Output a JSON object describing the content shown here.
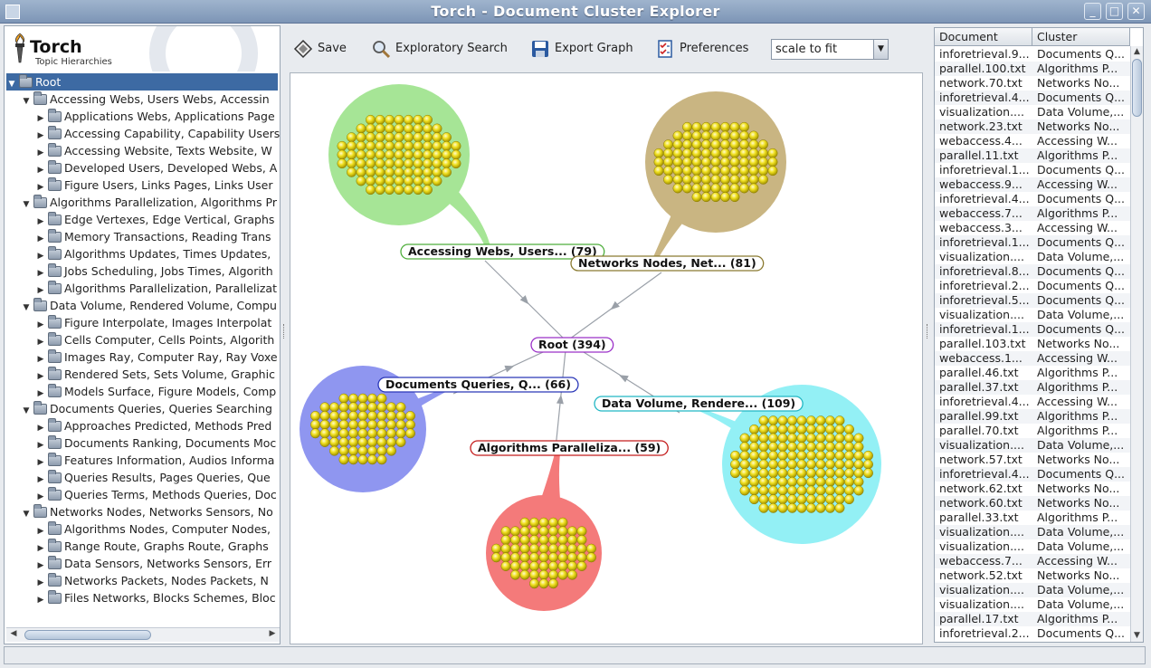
{
  "window": {
    "title": "Torch - Document Cluster Explorer",
    "minimize": "_",
    "maximize": "□",
    "close": "✕"
  },
  "logo": {
    "title": "Torch",
    "subtitle": "Topic Hierarchies"
  },
  "tree": {
    "root": "Root",
    "groups": [
      {
        "label": "Accessing Webs, Users Webs, Accessin",
        "children": [
          "Applications Webs, Applications Page",
          "Accessing Capability, Capability Users",
          "Accessing Website, Texts Website, W",
          "Developed Users, Developed Webs, A",
          "Figure Users, Links Pages, Links User"
        ]
      },
      {
        "label": "Algorithms Parallelization, Algorithms Pr",
        "children": [
          "Edge Vertexes, Edge Vertical, Graphs",
          "Memory Transactions, Reading Trans",
          "Algorithms Updates, Times Updates,",
          "Jobs Scheduling, Jobs Times, Algorith",
          "Algorithms Parallelization, Parallelizat"
        ]
      },
      {
        "label": "Data Volume, Rendered Volume, Compu",
        "children": [
          "Figure Interpolate, Images Interpolat",
          "Cells Computer, Cells Points, Algorith",
          "Images Ray, Computer Ray, Ray Voxe",
          "Rendered Sets, Sets Volume, Graphic",
          "Models Surface, Figure Models, Comp"
        ]
      },
      {
        "label": "Documents Queries, Queries Searching",
        "children": [
          "Approaches Predicted, Methods Pred",
          "Documents Ranking, Documents Moc",
          "Features Information, Audios Informa",
          "Queries Results, Pages Queries, Que",
          "Queries Terms, Methods Queries, Doc"
        ]
      },
      {
        "label": "Networks Nodes, Networks Sensors, No",
        "children": [
          "Algorithms Nodes, Computer Nodes,",
          "Range Route, Graphs Route, Graphs",
          "Data Sensors, Networks Sensors, Err",
          "Networks Packets, Nodes Packets, N",
          "Files Networks, Blocks Schemes, Bloc"
        ]
      }
    ]
  },
  "toolbar": {
    "save": "Save",
    "search": "Exploratory Search",
    "export": "Export Graph",
    "preferences": "Preferences",
    "scale": "scale to fit"
  },
  "graph": {
    "root_label": "Root (394)",
    "clusters": [
      {
        "label": "Accessing Webs, Users... (79)",
        "color": "#a6e596",
        "stroke": "#4fae3c"
      },
      {
        "label": "Networks Nodes, Net... (81)",
        "color": "#c9b582",
        "stroke": "#8a7a30"
      },
      {
        "label": "Documents Queries, Q... (66)",
        "color": "#8f96f0",
        "stroke": "#2a37b8"
      },
      {
        "label": "Data Volume, Rendere... (109)",
        "color": "#93f0f5",
        "stroke": "#22b7c4"
      },
      {
        "label": "Algorithms Paralleliza... (59)",
        "color": "#f47a7a",
        "stroke": "#c41c1c"
      }
    ]
  },
  "table": {
    "headers": [
      "Document",
      "Cluster"
    ],
    "rows": [
      [
        "inforetrieval.9...",
        "Documents Q..."
      ],
      [
        "parallel.100.txt",
        "Algorithms P..."
      ],
      [
        "network.70.txt",
        "Networks No..."
      ],
      [
        "inforetrieval.4...",
        "Documents Q..."
      ],
      [
        "visualization....",
        "Data Volume,..."
      ],
      [
        "network.23.txt",
        "Networks No..."
      ],
      [
        "webaccess.4...",
        "Accessing W..."
      ],
      [
        "parallel.11.txt",
        "Algorithms P..."
      ],
      [
        "inforetrieval.1...",
        "Documents Q..."
      ],
      [
        "webaccess.9...",
        "Accessing W..."
      ],
      [
        "inforetrieval.4...",
        "Documents Q..."
      ],
      [
        "webaccess.7...",
        "Algorithms P..."
      ],
      [
        "webaccess.3...",
        "Accessing W..."
      ],
      [
        "inforetrieval.1...",
        "Documents Q..."
      ],
      [
        "visualization....",
        "Data Volume,..."
      ],
      [
        "inforetrieval.8...",
        "Documents Q..."
      ],
      [
        "inforetrieval.2...",
        "Documents Q..."
      ],
      [
        "inforetrieval.5...",
        "Documents Q..."
      ],
      [
        "visualization....",
        "Data Volume,..."
      ],
      [
        "inforetrieval.1...",
        "Documents Q..."
      ],
      [
        "parallel.103.txt",
        "Networks No..."
      ],
      [
        "webaccess.1...",
        "Accessing W..."
      ],
      [
        "parallel.46.txt",
        "Algorithms P..."
      ],
      [
        "parallel.37.txt",
        "Algorithms P..."
      ],
      [
        "inforetrieval.4...",
        "Accessing W..."
      ],
      [
        "parallel.99.txt",
        "Algorithms P..."
      ],
      [
        "parallel.70.txt",
        "Algorithms P..."
      ],
      [
        "visualization....",
        "Data Volume,..."
      ],
      [
        "network.57.txt",
        "Networks No..."
      ],
      [
        "inforetrieval.4...",
        "Documents Q..."
      ],
      [
        "network.62.txt",
        "Networks No..."
      ],
      [
        "network.60.txt",
        "Networks No..."
      ],
      [
        "parallel.33.txt",
        "Algorithms P..."
      ],
      [
        "visualization....",
        "Data Volume,..."
      ],
      [
        "visualization....",
        "Data Volume,..."
      ],
      [
        "webaccess.7...",
        "Accessing W..."
      ],
      [
        "network.52.txt",
        "Networks No..."
      ],
      [
        "visualization....",
        "Data Volume,..."
      ],
      [
        "visualization....",
        "Data Volume,..."
      ],
      [
        "parallel.17.txt",
        "Algorithms P..."
      ],
      [
        "inforetrieval.2...",
        "Documents Q..."
      ]
    ]
  }
}
